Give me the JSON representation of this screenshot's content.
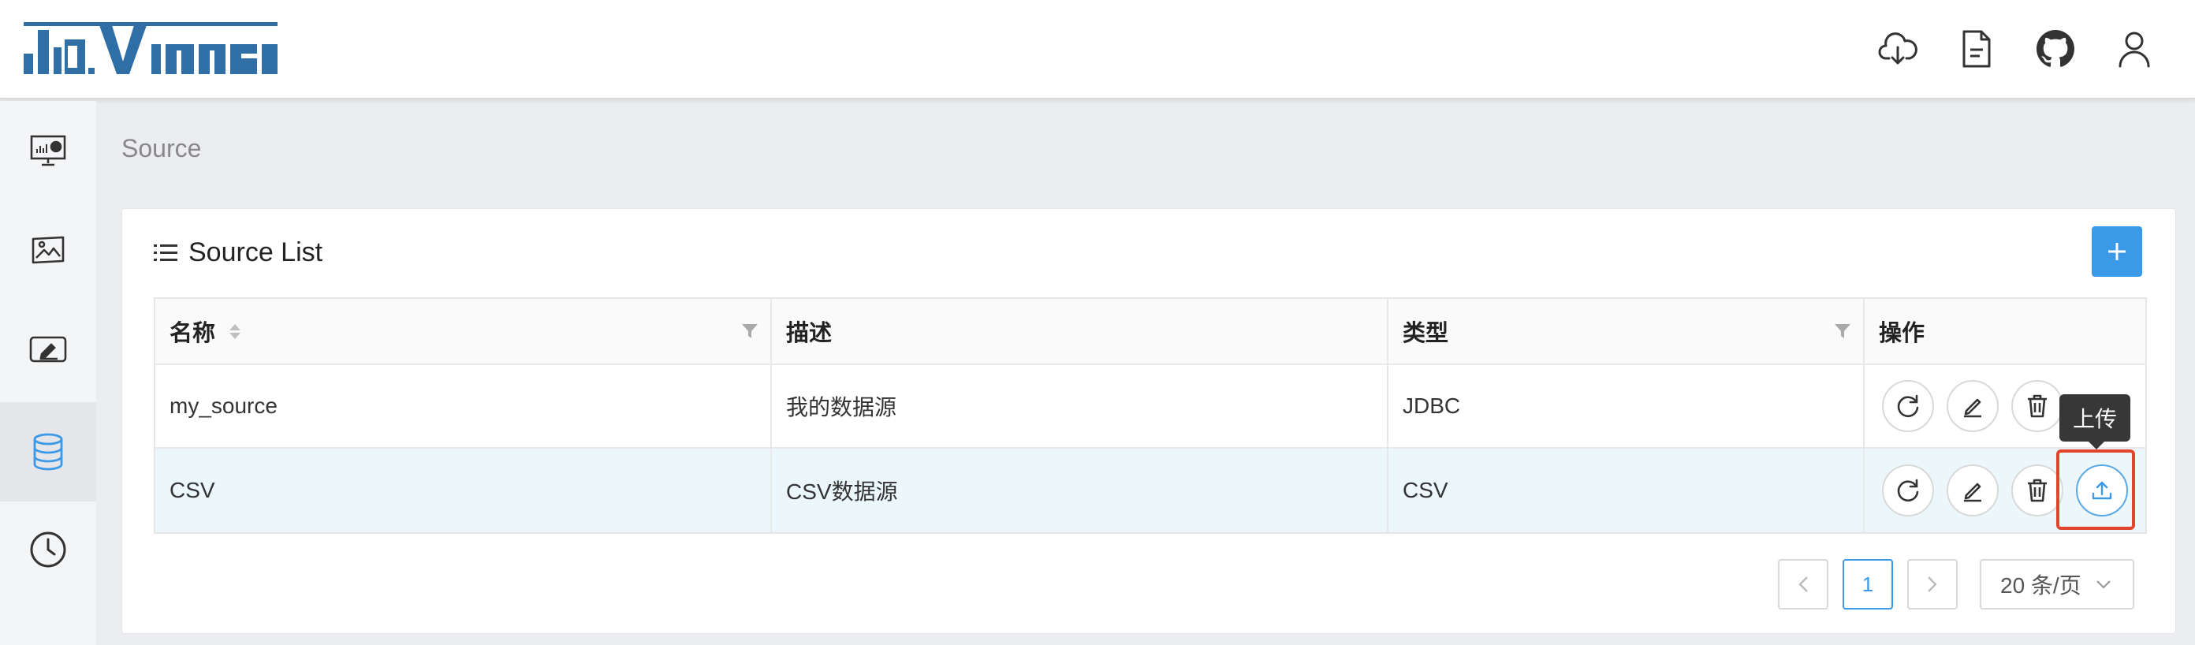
{
  "app": {
    "logo_text": "davinci"
  },
  "header": {
    "icons": [
      "cloud-download-icon",
      "document-icon",
      "github-icon",
      "user-icon"
    ]
  },
  "sidebar": {
    "items": [
      "dashboard-icon",
      "display-icon",
      "widget-icon",
      "source-icon",
      "schedule-icon"
    ],
    "active": "source-icon"
  },
  "breadcrumb": "Source",
  "card": {
    "title": "Source List",
    "add_label": "+"
  },
  "table": {
    "columns": [
      "名称",
      "描述",
      "类型",
      "操作"
    ],
    "rows": [
      {
        "name": "my_source",
        "description": "我的数据源",
        "type": "JDBC"
      },
      {
        "name": "CSV",
        "description": "CSV数据源",
        "type": "CSV"
      }
    ]
  },
  "tooltip": "上传",
  "pagination": {
    "current": "1",
    "page_size": "20 条/页"
  },
  "colors": {
    "accent": "#3a9ae8",
    "highlight_row": "#ebf7fb",
    "frame": "#e1462d"
  }
}
